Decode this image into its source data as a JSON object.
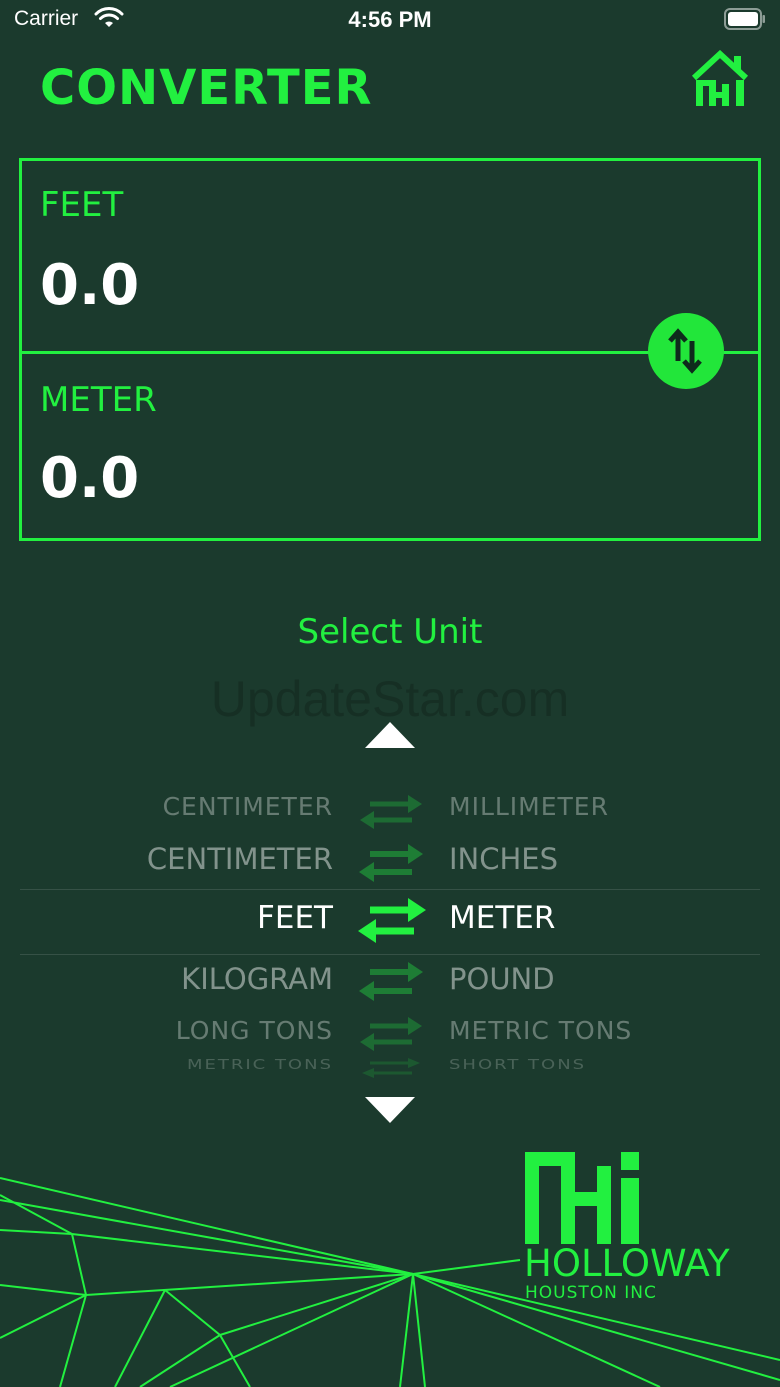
{
  "status_bar": {
    "carrier": "Carrier",
    "time": "4:56 PM",
    "wifi_icon": "wifi-icon",
    "battery_icon": "battery-icon"
  },
  "header": {
    "title": "CONVERTER",
    "home_icon": "house-logo-icon"
  },
  "converter": {
    "from_unit": "FEET",
    "from_value": "0.0",
    "to_unit": "METER",
    "to_value": "0.0",
    "swap_icon": "swap-vertical-arrows-icon"
  },
  "selector": {
    "title": "Select Unit",
    "watermark": "UpdateStar.com",
    "up_icon": "triangle-up-icon",
    "down_icon": "triangle-down-icon",
    "options": [
      {
        "from": "CENTIMETER",
        "to": "MILLIMETER"
      },
      {
        "from": "CENTIMETER",
        "to": "INCHES"
      },
      {
        "from": "FEET",
        "to": "METER",
        "selected": true
      },
      {
        "from": "KILOGRAM",
        "to": "POUND"
      },
      {
        "from": "LONG TONS",
        "to": "METRIC TONS"
      },
      {
        "from": "METRIC TONS",
        "to": "SHORT TONS"
      }
    ]
  },
  "brand": {
    "name": "HOLLOWAY",
    "subtitle": "HOUSTON INC",
    "logo_icon": "hhi-logo-icon"
  },
  "colors": {
    "background": "#1b3a2d",
    "accent": "#22f040",
    "text": "#ffffff"
  }
}
